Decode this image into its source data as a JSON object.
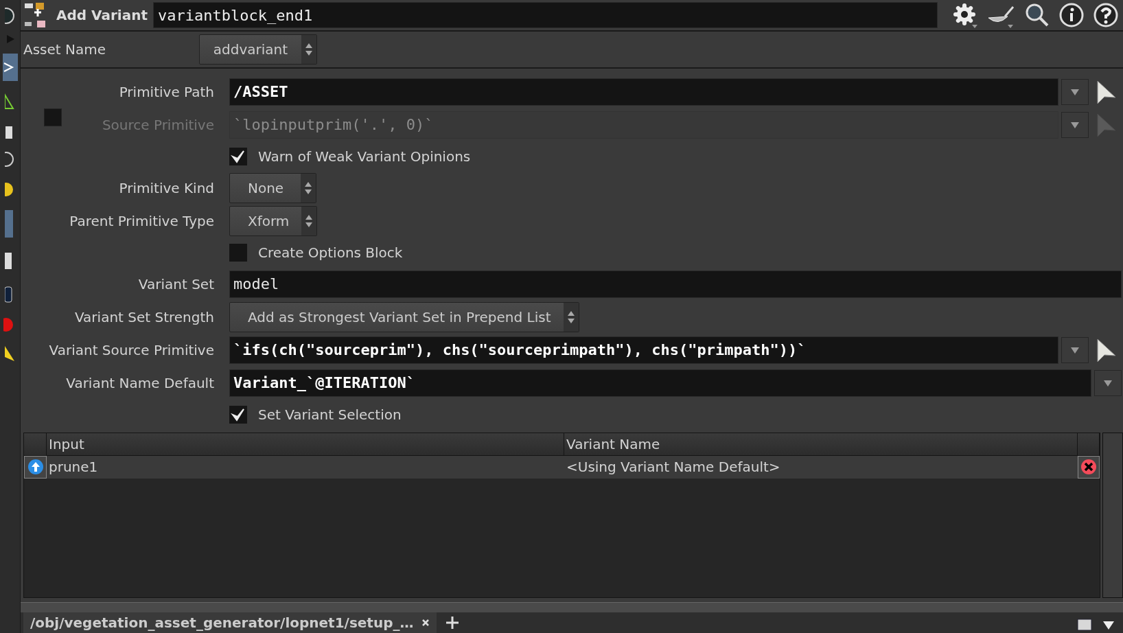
{
  "header": {
    "node_type": "Add Variant",
    "node_name": "variantblock_end1"
  },
  "asset_name": {
    "label": "Asset Name",
    "value": "addvariant"
  },
  "params": [
    {
      "kind": "field",
      "label": "Primitive Path",
      "value": "/ASSET",
      "bold": true,
      "disabled": false,
      "toggle": false,
      "dropdown": true,
      "picker": true
    },
    {
      "kind": "field",
      "label": "Source Primitive",
      "value": "`lopinputprim('.', 0)`",
      "bold": false,
      "disabled": true,
      "toggle": true,
      "checked": false,
      "dropdown": true,
      "picker": true
    },
    {
      "kind": "checkbox",
      "label": "Warn of Weak Variant Opinions",
      "checked": true
    },
    {
      "kind": "menu",
      "label": "Primitive Kind",
      "value": "None"
    },
    {
      "kind": "menu",
      "label": "Parent Primitive Type",
      "value": "Xform"
    },
    {
      "kind": "checkbox",
      "label": "Create Options Block",
      "checked": false
    },
    {
      "kind": "field",
      "label": "Variant Set",
      "value": "model",
      "bold": false,
      "disabled": false,
      "toggle": false,
      "dropdown": false,
      "picker": false
    },
    {
      "kind": "menu",
      "label": "Variant Set Strength",
      "value": "Add as Strongest Variant Set in Prepend List"
    },
    {
      "kind": "field",
      "label": "Variant Source Primitive",
      "value": "`ifs(ch(\"sourceprim\"), chs(\"sourceprimpath\"), chs(\"primpath\"))`",
      "bold": true,
      "disabled": false,
      "toggle": false,
      "dropdown": true,
      "picker": true
    },
    {
      "kind": "field",
      "label": "Variant Name Default",
      "value": "Variant_`@ITERATION`",
      "bold": true,
      "disabled": false,
      "toggle": false,
      "dropdown": true,
      "picker": false
    },
    {
      "kind": "checkbox",
      "label": "Set Variant Selection",
      "checked": true
    }
  ],
  "table": {
    "columns": [
      "Input",
      "Variant Name"
    ],
    "rows": [
      {
        "input": "prune1",
        "variant_name": "<Using Variant Name Default>"
      }
    ]
  },
  "tabs": [
    {
      "label": "/obj/vegetation_asset_generator/lopnet1/setup_…",
      "selected": true
    }
  ]
}
